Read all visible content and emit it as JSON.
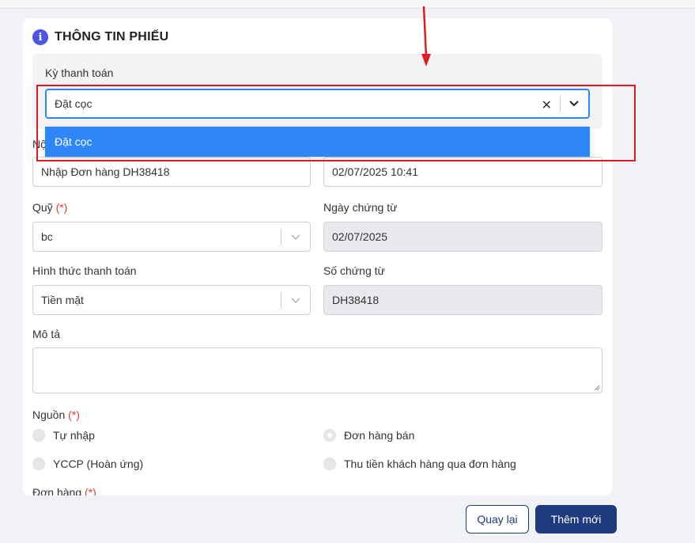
{
  "form": {
    "title": "THÔNG TIN PHIẾU",
    "ky_thanh_toan": {
      "label": "Kỳ thanh toán",
      "value": "Đặt cọc",
      "options": [
        "Đặt cọc"
      ]
    },
    "noi_dung": {
      "label_partial": "Nộ",
      "value": "Nhập Đơn hàng DH38418"
    },
    "ngay": {
      "value": "02/07/2025 10:41"
    },
    "quy": {
      "label": "Quỹ",
      "required": "(*)",
      "value": "bc"
    },
    "ngay_chung_tu": {
      "label": "Ngày chứng từ",
      "value": "02/07/2025"
    },
    "hinh_thuc": {
      "label": "Hình thức thanh toán",
      "value": "Tiền mặt"
    },
    "so_chung_tu": {
      "label": "Số chứng từ",
      "value": "DH38418"
    },
    "mo_ta": {
      "label": "Mô tả",
      "value": ""
    },
    "nguon": {
      "label": "Nguồn",
      "required": "(*)",
      "options": [
        "Tự nhập",
        "Đơn hàng bán",
        "YCCP (Hoàn ứng)",
        "Thu tiền khách hàng qua đơn hàng"
      ]
    },
    "don_hang": {
      "label": "Đơn hàng",
      "required": "(*)"
    }
  },
  "actions": {
    "back": "Quay lại",
    "add": "Thêm mới"
  },
  "colors": {
    "primary": "#2f86f6",
    "navy": "#1f3b80",
    "annotation": "#e01b24",
    "required": "#e03a3a"
  }
}
